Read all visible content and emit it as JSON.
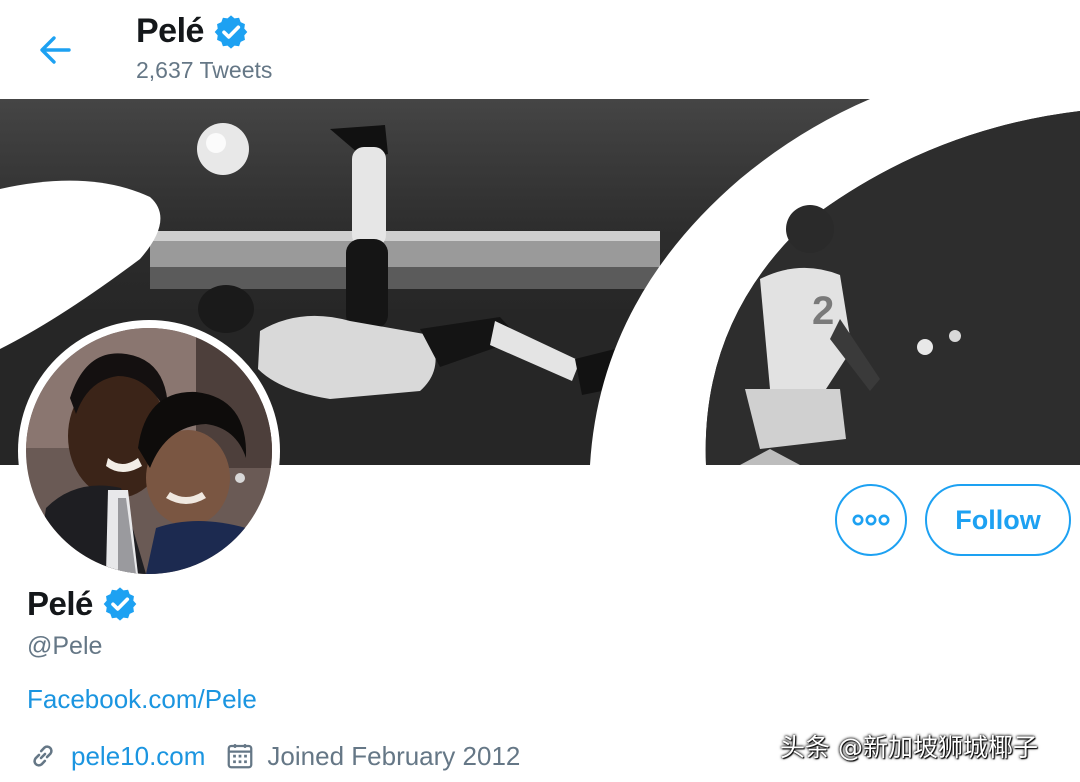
{
  "header": {
    "name": "Pelé",
    "tweet_count": "2,637 Tweets"
  },
  "icons": {
    "back": "arrow-left-icon",
    "verified": "verified-badge-icon",
    "more": "more-options-icon",
    "link": "link-icon",
    "calendar": "calendar-icon"
  },
  "actions": {
    "follow_label": "Follow"
  },
  "profile": {
    "name": "Pelé",
    "handle": "@Pele",
    "bio_link": "Facebook.com/Pele",
    "website": "pele10.com",
    "joined": "Joined February 2012"
  },
  "watermark": "头条 @新加坡狮城椰子",
  "colors": {
    "accent": "#1da1f2",
    "link": "#1b95e0",
    "secondary_text": "#657786",
    "primary_text": "#14171a"
  }
}
